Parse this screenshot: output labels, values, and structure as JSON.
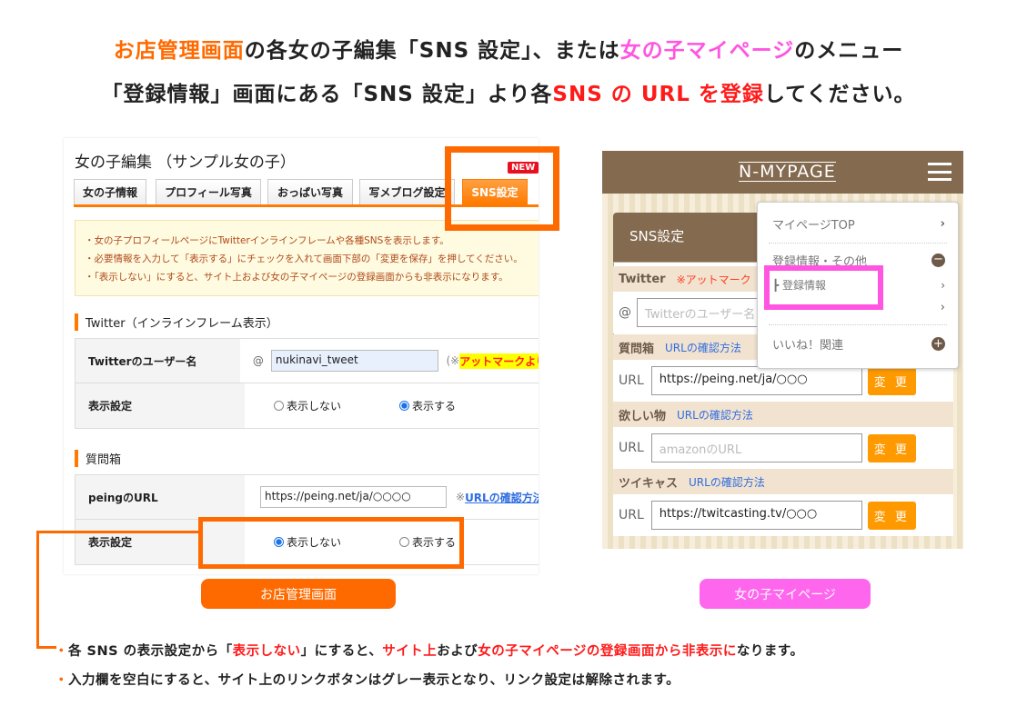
{
  "headline": {
    "line1": [
      "お店管理画面",
      "の各女の子編集「SNS 設定」、または",
      "女の子マイページ",
      "のメニュー"
    ],
    "line2": [
      "「登録情報」画面にある「SNS 設定」より各",
      "SNS の URL を登録",
      "してください。"
    ]
  },
  "admin": {
    "title": "女の子編集 （サンプル女の子）",
    "tabs": [
      "女の子情報",
      "プロフィール写真",
      "おっぱい写真",
      "写メブログ設定",
      "SNS設定"
    ],
    "new_badge": "NEW",
    "info": [
      "・女の子プロフィールページにTwitterインラインフレームや各種SNSを表示します。",
      "・必要情報を入力して「表示する」にチェックを入れて画面下部の「変更を保存」を押してください。",
      "・「表示しない」にすると、サイト上および女の子マイページの登録画面からも非表示になります。"
    ],
    "twitter_section": "Twitter（インラインフレーム表示）",
    "twitter_label": "Twitterのユーザー名",
    "at": "@",
    "twitter_value": "nukinavi_tweet",
    "twitter_note_prefix": "(※",
    "twitter_note": "アットマークより",
    "display_label": "表示設定",
    "hide": "表示しない",
    "show": "表示する",
    "qa_section": "質問箱",
    "peing_label": "peingのURL",
    "peing_value": "https://peing.net/ja/○○○○",
    "url_note_prefix": "※",
    "url_note": "URLの確認方法",
    "caption": "お店管理画面"
  },
  "mypage": {
    "logo": "N-MYPAGE",
    "panel_title": "SNS設定",
    "twitter": "Twitter",
    "twitter_note": "※アットマーク",
    "twitter_placeholder": "Twitterのユーザー名",
    "sections": [
      {
        "name": "質問箱",
        "link": "URLの確認方法",
        "label": "URL",
        "value": "https://peing.net/ja/○○○",
        "placeholder": ""
      },
      {
        "name": "欲しい物",
        "link": "URLの確認方法",
        "label": "URL",
        "value": "",
        "placeholder": "amazonのURL"
      },
      {
        "name": "ツイキャス",
        "link": "URLの確認方法",
        "label": "URL",
        "value": "https://twitcasting.tv/○○○",
        "placeholder": ""
      }
    ],
    "change": "変 更",
    "menu": {
      "top": "マイページTOP",
      "reg_other": "登録情報・その他",
      "reg": "┣ 登録情報",
      "likes": "いいね！関連"
    },
    "caption": "女の子マイページ"
  },
  "notes": {
    "n1": [
      "・各 SNS の表示設定から「",
      "表示しない",
      "」にすると、",
      "サイト上",
      "および",
      "女の子マイページの登録画面から非表示に",
      "なります。"
    ],
    "n2": "・入力欄を空白にすると、サイト上のリンクボタンはグレー表示となり、リンク設定は解除されます。"
  },
  "colors": {
    "orange": "#ff6a00",
    "pink": "#ff55e0",
    "red": "#ff1a1a",
    "brown": "#846a4f"
  }
}
